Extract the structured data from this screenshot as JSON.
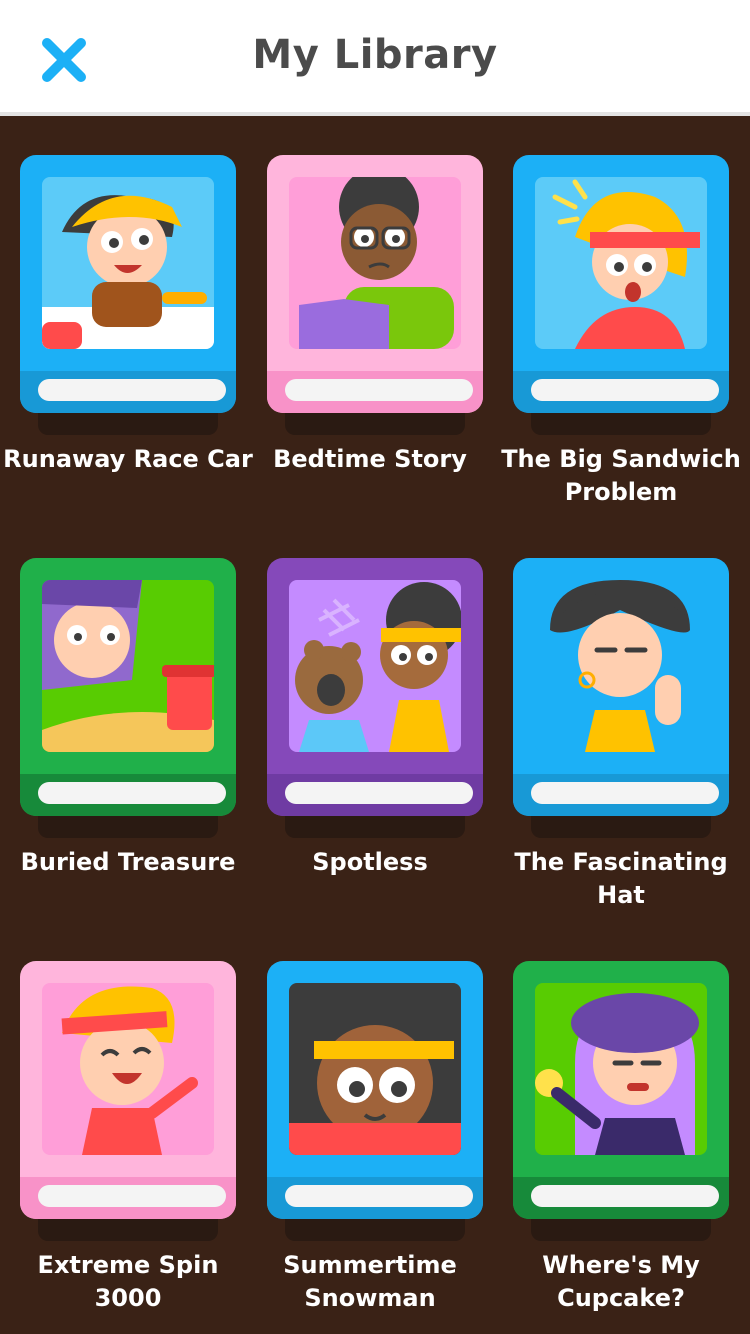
{
  "header": {
    "title": "My Library",
    "close_icon": "close-icon"
  },
  "books": [
    {
      "title": "Runaway Race Car",
      "color": "#1cb0f6"
    },
    {
      "title": "Bedtime Story",
      "color": "#ffb5dc"
    },
    {
      "title": "The Big Sandwich Problem",
      "color": "#1cb0f6"
    },
    {
      "title": "Buried Treasure",
      "color": "#20b04a"
    },
    {
      "title": "Spotless",
      "color": "#8549ba"
    },
    {
      "title": "The Fascinating Hat",
      "color": "#1cb0f6"
    },
    {
      "title": "Extreme Spin 3000",
      "color": "#ffb5dc"
    },
    {
      "title": "Summertime Snowman",
      "color": "#1cb0f6"
    },
    {
      "title": "Where's My Cupcake?",
      "color": "#20b04a"
    }
  ]
}
